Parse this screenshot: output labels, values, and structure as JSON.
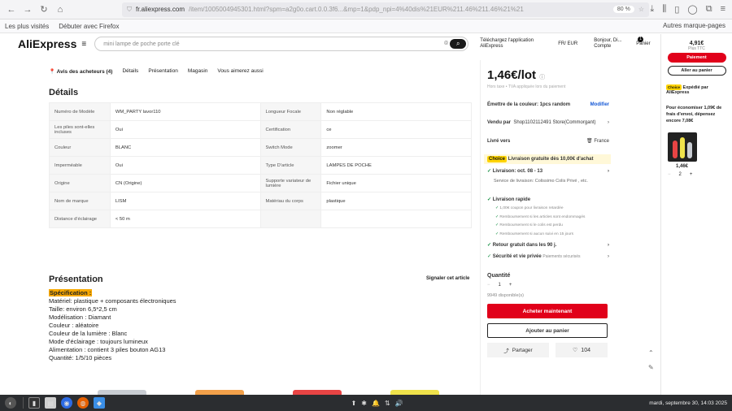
{
  "browser": {
    "url_domain": "fr.aliexpress.com",
    "url_rest": "/item/1005004945301.html?spm=a2g0o.cart.0.0.3f6...&mp=1&pdp_npi=4%40dis%21EUR%211.46%211.46%21%21",
    "zoom": "80 %",
    "bookmarks": [
      "Les plus visités",
      "Débuter avec Firefox"
    ],
    "bookmark_right": "Autres marque-pages"
  },
  "header": {
    "logo": "AliExpress",
    "search_placeholder": "mini lampe de poche porte clé",
    "app_text": "Téléchargez l'application AliExpress",
    "lang_text": "FR/ EUR",
    "account_text": "Bonjour, Di... Compte",
    "cart_count": "1",
    "cart_label": "Panier"
  },
  "subnav": [
    "Avis des acheteurs (4)",
    "Détails",
    "Présentation",
    "Magasin",
    "Vous aimerez aussi"
  ],
  "details": {
    "title": "Détails",
    "rows": [
      [
        "Numéro de Modèle",
        "WM_PARTY lavor110",
        "Longueur Focale",
        "Non réglable"
      ],
      [
        "Les piles sont-elles incluses",
        "Oui",
        "Certification",
        "ce"
      ],
      [
        "Couleur",
        "BLANC",
        "Switch Mode",
        "zoomer"
      ],
      [
        "Imperméable",
        "Oui",
        "Type D'article",
        "LAMPES DE POCHE"
      ],
      [
        "Origine",
        "CN (Origine)",
        "Supporte variateur de lumière",
        "Fichier unique"
      ],
      [
        "Nom de marque",
        "LISM",
        "Matériau du corps",
        "plastique"
      ],
      [
        "Distance d'éclairage",
        "< 50 m",
        "",
        ""
      ]
    ]
  },
  "presentation": {
    "title": "Présentation",
    "report": "Signaler cet article",
    "highlight": "Spécification :",
    "lines": [
      "Matériel: plastique + composants électroniques",
      "Taille: environ 6,5*2,5 cm",
      "Modélisation : Diamant",
      "Couleur : aléatoire",
      "Couleur de la lumière : Blanc",
      "Mode d'éclairage : toujours lumineux",
      "Alimentation : contient 3 piles bouton AG13",
      "Quantité: 1/5/10 pièces"
    ]
  },
  "panel": {
    "price": "1,46€/lot",
    "tax": "Hors taxe • TVA appliquée lors du paiement",
    "color_label": "Émettre de la couleur: 1pcs random",
    "modify": "Modifier",
    "sold_by": "Vendu par",
    "store": "Shop1102112491 Store(Commorgant)",
    "ship_label": "Livré vers",
    "ship_dest": "France",
    "choice": "Choice",
    "choice_text": "Livraison gratuite dès 10,00€ d'achat",
    "delivery": "Livraison: oct. 08 - 13",
    "delivery_sub": "Service de livraison: Colissimo  Colis Privé , etc.",
    "fast": "Livraison rapide",
    "fast_items": [
      "1,00€ coupon pour livraison retardée",
      "Remboursement si les articles sont endommagés",
      "Remboursement si le colis est perdu",
      "Remboursement si aucun suivi en 15 jours"
    ],
    "return": "Retour gratuit dans les 90 j.",
    "security": "Sécurité et vie privée",
    "security_sub": "Paiements sécurisés",
    "qty_label": "Quantité",
    "qty": "1",
    "stock": "9949 disponible(s)",
    "buy": "Acheter maintenant",
    "add_cart": "Ajouter au panier",
    "share": "Partager",
    "likes": "104"
  },
  "right": {
    "price": "4,91€",
    "tax": "Plus TTC",
    "pay": "Paiement",
    "goto_cart": "Aller au panier",
    "choice_ship": "Expédié par AliExpress",
    "promo": "Pour économiser 1,09€ de frais d'envoi, dépensez encore 7,08€",
    "item_price": "1,46€",
    "item_qty": "2"
  },
  "taskbar": {
    "clock": "mardi, septembre 30, 14:03 2025"
  }
}
